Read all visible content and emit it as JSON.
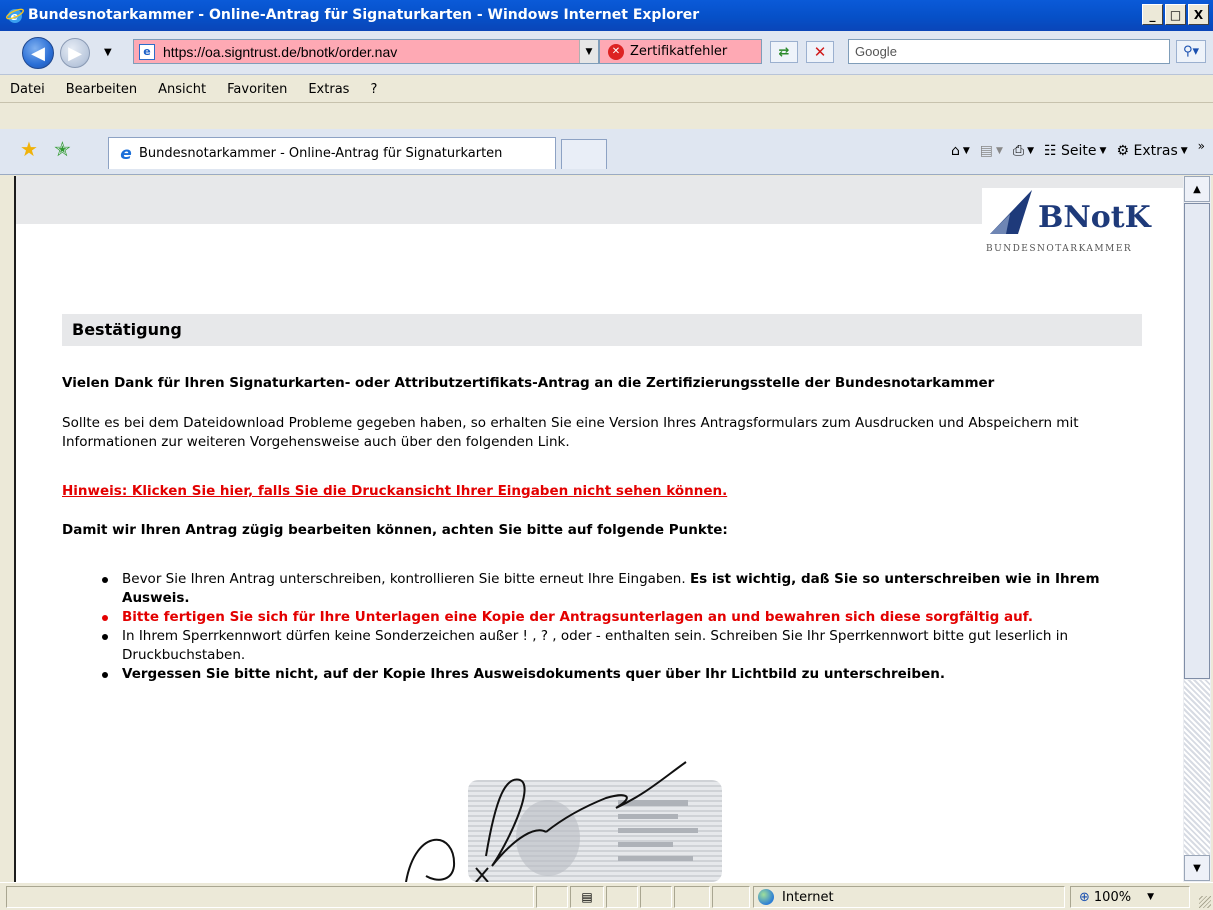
{
  "window": {
    "title": "Bundesnotarkammer - Online-Antrag für Signaturkarten - Windows Internet Explorer",
    "buttons": [
      "_",
      "□",
      "X"
    ]
  },
  "address_bar": {
    "url": "https://oa.signtrust.de/bnotk/order.nav",
    "certificate_error": "Zertifikatfehler",
    "search_placeholder": "Google",
    "url_background": "#fea9b4"
  },
  "menu": {
    "items": [
      "Datei",
      "Bearbeiten",
      "Ansicht",
      "Favoriten",
      "Extras",
      "?"
    ]
  },
  "tabs": {
    "active_tab": "Bundesnotarkammer - Online-Antrag für Signaturkarten"
  },
  "command_bar": {
    "page_label": "Seite",
    "tools_label": "Extras"
  },
  "page": {
    "logo": {
      "brand": "BNotK",
      "subtitle": "BUNDESNOTARKAMMER"
    },
    "heading": "Bestätigung",
    "thanks": "Vielen Dank für Ihren Signaturkarten- oder Attributzertifikats-Antrag an die Zertifizierungsstelle der Bundesnotarkammer",
    "info": "Sollte es bei dem Dateidownload Probleme gegeben haben, so erhalten Sie eine Version Ihres Antragsformulars zum Ausdrucken und Abspeichern mit Informationen zur weiteren Vorgehensweise auch über den folgenden Link.",
    "hint_link": "Hinweis: Klicken Sie hier, falls Sie die Druckansicht Ihrer Eingaben nicht sehen können.",
    "intro": "Damit wir Ihren Antrag zügig bearbeiten können, achten Sie bitte auf folgende Punkte:",
    "points": {
      "p1_normal": "Bevor Sie Ihren Antrag unterschreiben, kontrollieren Sie bitte erneut Ihre Eingaben. ",
      "p1_bold": "Es ist wichtig, daß Sie so unterschreiben wie in Ihrem Ausweis.",
      "p2": "Bitte fertigen Sie sich für Ihre Unterlagen eine Kopie der Antragsunterlagen an und bewahren sich diese sorgfältig auf.",
      "p3": "In Ihrem Sperrkennwort dürfen keine Sonderzeichen außer ! , ? , oder - enthalten sein. Schreiben Sie Ihr Sperrkennwort bitte gut leserlich in Druckbuchstaben.",
      "p4": "Vergessen Sie bitte nicht, auf der Kopie Ihres Ausweisdokuments quer über Ihr Lichtbild zu unterschreiben."
    },
    "accent_red": "#e30000"
  },
  "status_bar": {
    "zone": "Internet",
    "zoom": "100%"
  }
}
